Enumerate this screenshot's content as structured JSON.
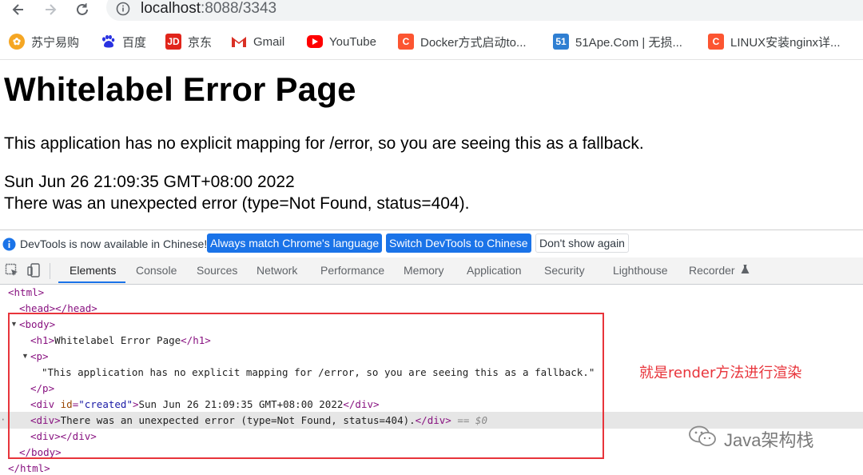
{
  "browser": {
    "url_host": "localhost",
    "url_path": ":8088/3343"
  },
  "bookmarks": [
    {
      "label": "苏宁易购",
      "icon": "suning-icon",
      "color": "#f5a623"
    },
    {
      "label": "百度",
      "icon": "baidu-paw-icon",
      "color": "#2932e1"
    },
    {
      "label": "京东",
      "icon": "jd-icon",
      "color": "#e1251b",
      "icon_text": "JD"
    },
    {
      "label": "Gmail",
      "icon": "gmail-icon",
      "color": "#d93025"
    },
    {
      "label": "YouTube",
      "icon": "youtube-icon",
      "color": "#ff0000"
    },
    {
      "label": "Docker方式启动to...",
      "icon": "c-orange-icon",
      "color": "#fc5531",
      "icon_text": "C"
    },
    {
      "label": "51Ape.Com | 无损...",
      "icon": "51ape-icon",
      "color": "#2f7fd2",
      "icon_text": "51"
    },
    {
      "label": "LINUX安装nginx详...",
      "icon": "c-orange-icon",
      "color": "#fc5531",
      "icon_text": "C"
    }
  ],
  "page": {
    "title": "Whitelabel Error Page",
    "message": "This application has no explicit mapping for /error, so you are seeing this as a fallback.",
    "date": "Sun Jun 26 21:09:35 GMT+08:00 2022",
    "error": "There was an unexpected error (type=Not Found, status=404)."
  },
  "devtools": {
    "info_message": "DevTools is now available in Chinese!",
    "btn_match": "Always match Chrome's language",
    "btn_switch": "Switch DevTools to Chinese",
    "btn_dismiss": "Don't show again",
    "tabs": [
      "Elements",
      "Console",
      "Sources",
      "Network",
      "Performance",
      "Memory",
      "Application",
      "Security",
      "Lighthouse",
      "Recorder"
    ],
    "active_tab": "Elements",
    "dom": {
      "html_open": "<html>",
      "head": "<head></head>",
      "body_open": "<body>",
      "h1_open": "<h1>",
      "h1_text": "Whitelabel Error Page",
      "h1_close": "</h1>",
      "p_open": "<p>",
      "p_text": "\"This application has no explicit mapping for /error, so you are seeing this as a fallback.\"",
      "p_close": "</p>",
      "div_open_a": "<div ",
      "div_attr_name": "id",
      "div_attr_eq": "=",
      "div_attr_val": "\"created\"",
      "div_open_b": ">",
      "div_text": "Sun Jun 26 21:09:35 GMT+08:00 2022",
      "div_close": "</div>",
      "div2_open": "<div>",
      "div2_text": "There was an unexpected error (type=Not Found, status=404).",
      "div2_close": "</div>",
      "div2_marker": "== $0",
      "div3": "<div></div>",
      "body_close": "</body>",
      "html_close": "</html>"
    }
  },
  "annotation": "就是render方法进行渲染",
  "watermark": "Java架构栈",
  "colors": {
    "accent": "#1a73e8",
    "annotation_red": "#e8343b",
    "tag": "#881280",
    "attr_name": "#994500",
    "attr_value": "#1a1aa6"
  }
}
